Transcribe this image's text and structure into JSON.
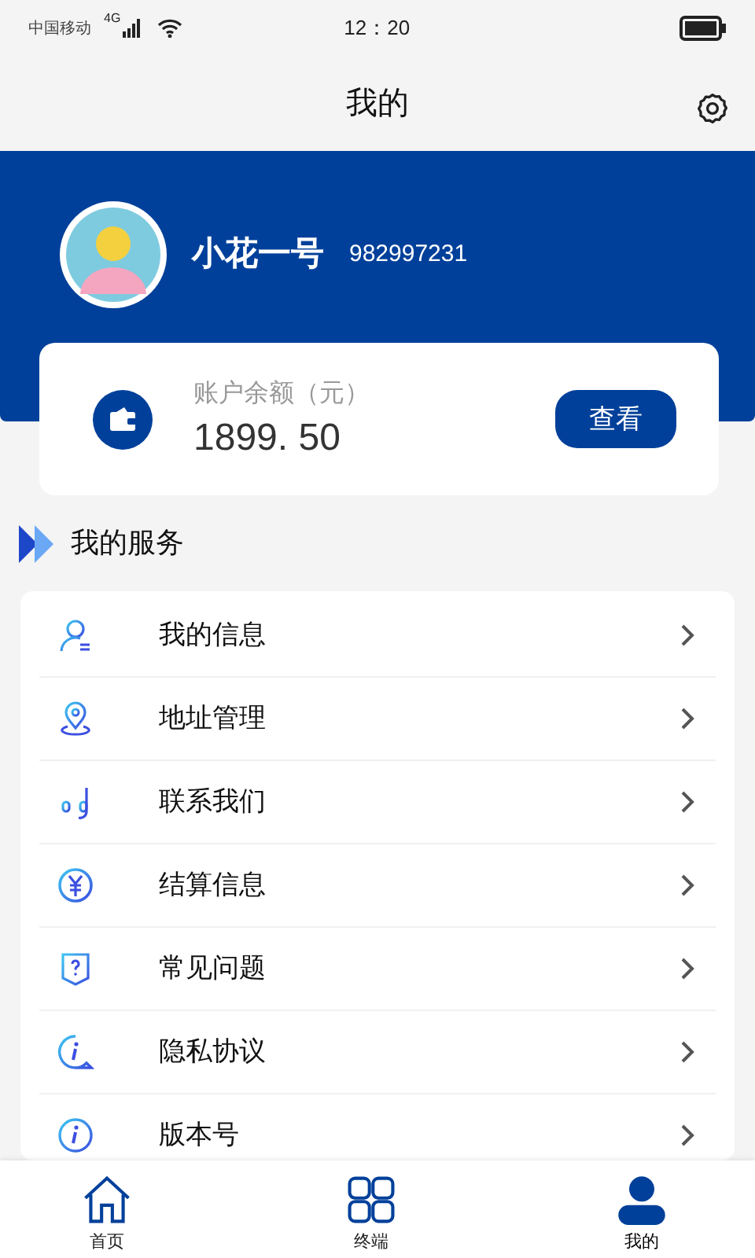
{
  "status_bar": {
    "carrier": "中国移动",
    "network": "4G",
    "time": "12：20"
  },
  "header": {
    "title": "我的"
  },
  "profile": {
    "name": "小花一号",
    "id": "982997231"
  },
  "balance": {
    "label": "账户余额（元）",
    "amount": "1899. 50",
    "button": "查看"
  },
  "services": {
    "title": "我的服务",
    "items": [
      {
        "label": "我的信息"
      },
      {
        "label": "地址管理"
      },
      {
        "label": "联系我们"
      },
      {
        "label": "结算信息"
      },
      {
        "label": "常见问题"
      },
      {
        "label": "隐私协议"
      },
      {
        "label": "版本号"
      }
    ]
  },
  "tab_bar": [
    {
      "label": "首页",
      "selected": false
    },
    {
      "label": "终端",
      "selected": false
    },
    {
      "label": "我的",
      "selected": true
    }
  ]
}
